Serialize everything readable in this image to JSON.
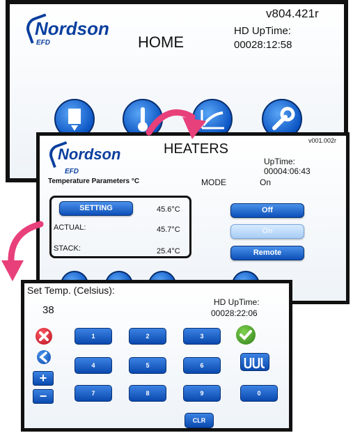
{
  "home": {
    "brand": "Nordson",
    "brand_sub": "EFD",
    "title": "HOME",
    "version": "v804.421r",
    "uptime_label": "HD UpTime:",
    "uptime_value": "00028:12:58",
    "nav_icons": [
      "dispense-icon",
      "thermometer-icon",
      "graph-icon",
      "wrench-icon"
    ]
  },
  "heaters": {
    "brand": "Nordson",
    "brand_sub": "EFD",
    "title": "HEATERS",
    "version": "v001.002r",
    "uptime_label": "UpTime:",
    "uptime_value": "00004:06:43",
    "params_label": "Temperature Parameters °C",
    "mode_label": "MODE",
    "mode_value": "On",
    "setting_label": "SETTING",
    "setting_value": "45.6°C",
    "actual_label": "ACTUAL:",
    "actual_value": "45.7°C",
    "stack_label": "STACK:",
    "stack_value": "25.4°C",
    "off_label": "Off",
    "on_label": "On",
    "remote_label": "Remote"
  },
  "keypad": {
    "title": "Set Temp. (Celsius):",
    "entry": "38",
    "uptime_label": "HD UpTime:",
    "uptime_value": "00028:22:06",
    "keys": [
      "1",
      "2",
      "3",
      "4",
      "5",
      "6",
      "7",
      "8",
      "9",
      "0"
    ],
    "clr_label": "CLR",
    "plus": "+",
    "minus": "−"
  },
  "colors": {
    "brand_blue": "#0a3f9e",
    "button_blue": "#0c4fb8",
    "callout_pink": "#e8407a",
    "cancel_red": "#c0152a",
    "accept_green": "#3e9b22"
  }
}
